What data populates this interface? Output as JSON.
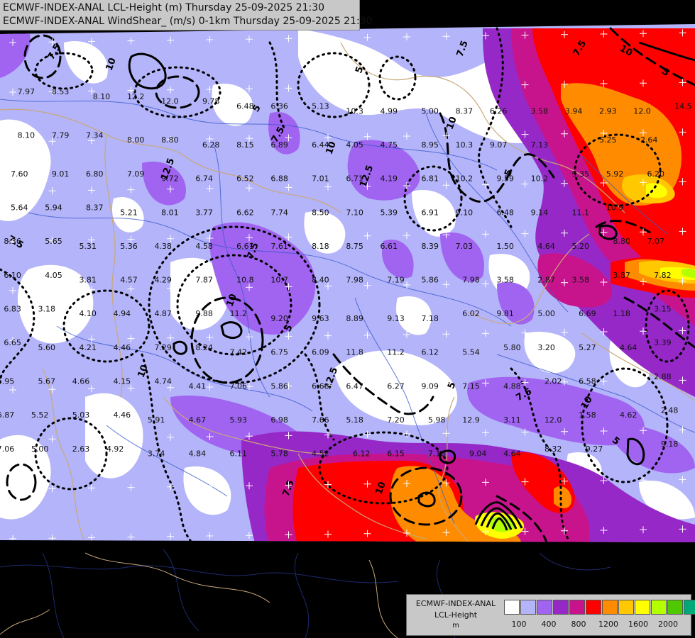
{
  "header": {
    "title_line_1": "ECMWF-INDEX-ANAL LCL-Height (m) Thursday 25-09-2025 21:30",
    "title_line_2": "ECMWF-INDEX-ANAL WindShear_ (m/s) 0-1km Thursday 25-09-2025 21:30"
  },
  "legend": {
    "line_1": "ECMWF-INDEX-ANAL",
    "line_2": "LCL-Height",
    "line_3": "m",
    "colors": [
      "#ffffff",
      "#b4b4fa",
      "#a064f0",
      "#9628c8",
      "#c8148c",
      "#ff0000",
      "#ff8c00",
      "#ffc800",
      "#ffff00",
      "#b4ff00",
      "#50c800",
      "#00aa78",
      "#00b4ff"
    ],
    "ticks": [
      "100",
      "400",
      "800",
      "1200",
      "1600",
      "2000"
    ]
  },
  "map": {
    "background_color": "#000000",
    "shear_contour_labels": [
      "7.5",
      "10",
      "12.5",
      "5",
      "7.5",
      "10",
      "5",
      "7.5",
      "10",
      "12.5",
      "5",
      "7.5",
      "10",
      "5",
      "7.5",
      "10",
      "5",
      "7.5",
      "10",
      "12.5",
      "5",
      "7.5",
      "10",
      "5",
      "7.5",
      "10"
    ],
    "station_values": [
      {
        "value": "7.97",
        "c": 0.03,
        "r": 0.1
      },
      {
        "value": "8.53",
        "c": 0.08,
        "r": 0.1
      },
      {
        "value": "8.10",
        "c": 0.14,
        "r": 0.11
      },
      {
        "value": "12.2",
        "c": 0.19,
        "r": 0.11
      },
      {
        "value": "12.0",
        "c": 0.24,
        "r": 0.12
      },
      {
        "value": "9.78",
        "c": 0.3,
        "r": 0.12
      },
      {
        "value": "6.48",
        "c": 0.35,
        "r": 0.13
      },
      {
        "value": "6.36",
        "c": 0.4,
        "r": 0.13
      },
      {
        "value": "5.13",
        "c": 0.46,
        "r": 0.13
      },
      {
        "value": "10.3",
        "c": 0.51,
        "r": 0.14
      },
      {
        "value": "4.99",
        "c": 0.56,
        "r": 0.14
      },
      {
        "value": "5.00",
        "c": 0.62,
        "r": 0.14
      },
      {
        "value": "8.37",
        "c": 0.67,
        "r": 0.14
      },
      {
        "value": "6.26",
        "c": 0.72,
        "r": 0.14
      },
      {
        "value": "3.58",
        "c": 0.78,
        "r": 0.14
      },
      {
        "value": "3.94",
        "c": 0.83,
        "r": 0.14
      },
      {
        "value": "2.93",
        "c": 0.88,
        "r": 0.14
      },
      {
        "value": "12.0",
        "c": 0.93,
        "r": 0.14
      },
      {
        "value": "14.5",
        "c": 0.99,
        "r": 0.13
      },
      {
        "value": "8.10",
        "c": 0.03,
        "r": 0.19
      },
      {
        "value": "7.79",
        "c": 0.08,
        "r": 0.19
      },
      {
        "value": "7.34",
        "c": 0.13,
        "r": 0.19
      },
      {
        "value": "8.00",
        "c": 0.19,
        "r": 0.2
      },
      {
        "value": "8.80",
        "c": 0.24,
        "r": 0.2
      },
      {
        "value": "6.28",
        "c": 0.3,
        "r": 0.21
      },
      {
        "value": "8.15",
        "c": 0.35,
        "r": 0.21
      },
      {
        "value": "6.89",
        "c": 0.4,
        "r": 0.21
      },
      {
        "value": "6.44",
        "c": 0.46,
        "r": 0.21
      },
      {
        "value": "4.05",
        "c": 0.51,
        "r": 0.21
      },
      {
        "value": "4.75",
        "c": 0.56,
        "r": 0.21
      },
      {
        "value": "8.95",
        "c": 0.62,
        "r": 0.21
      },
      {
        "value": "10.3",
        "c": 0.67,
        "r": 0.21
      },
      {
        "value": "9.07",
        "c": 0.72,
        "r": 0.21
      },
      {
        "value": "7.13",
        "c": 0.78,
        "r": 0.21
      },
      {
        "value": "5.25",
        "c": 0.88,
        "r": 0.2
      },
      {
        "value": "2.64",
        "c": 0.94,
        "r": 0.2
      },
      {
        "value": "7.60",
        "c": 0.02,
        "r": 0.27
      },
      {
        "value": "9.01",
        "c": 0.08,
        "r": 0.27
      },
      {
        "value": "6.80",
        "c": 0.13,
        "r": 0.27
      },
      {
        "value": "7.09",
        "c": 0.19,
        "r": 0.27
      },
      {
        "value": "9.72",
        "c": 0.24,
        "r": 0.28
      },
      {
        "value": "6.74",
        "c": 0.29,
        "r": 0.28
      },
      {
        "value": "6.52",
        "c": 0.35,
        "r": 0.28
      },
      {
        "value": "6.88",
        "c": 0.4,
        "r": 0.28
      },
      {
        "value": "7.01",
        "c": 0.46,
        "r": 0.28
      },
      {
        "value": "6.71",
        "c": 0.51,
        "r": 0.28
      },
      {
        "value": "4.19",
        "c": 0.56,
        "r": 0.28
      },
      {
        "value": "6.81",
        "c": 0.62,
        "r": 0.28
      },
      {
        "value": "10.2",
        "c": 0.67,
        "r": 0.28
      },
      {
        "value": "9.59",
        "c": 0.73,
        "r": 0.28
      },
      {
        "value": "10.2",
        "c": 0.78,
        "r": 0.28
      },
      {
        "value": "9.35",
        "c": 0.84,
        "r": 0.27
      },
      {
        "value": "5.92",
        "c": 0.89,
        "r": 0.27
      },
      {
        "value": "6.20",
        "c": 0.95,
        "r": 0.27
      },
      {
        "value": "5.64",
        "c": 0.02,
        "r": 0.34
      },
      {
        "value": "5.94",
        "c": 0.07,
        "r": 0.34
      },
      {
        "value": "8.37",
        "c": 0.13,
        "r": 0.34
      },
      {
        "value": "5.21",
        "c": 0.18,
        "r": 0.35
      },
      {
        "value": "8.01",
        "c": 0.24,
        "r": 0.35
      },
      {
        "value": "3.77",
        "c": 0.29,
        "r": 0.35
      },
      {
        "value": "6.62",
        "c": 0.35,
        "r": 0.35
      },
      {
        "value": "7.74",
        "c": 0.4,
        "r": 0.35
      },
      {
        "value": "8.50",
        "c": 0.46,
        "r": 0.35
      },
      {
        "value": "7.10",
        "c": 0.51,
        "r": 0.35
      },
      {
        "value": "5.39",
        "c": 0.56,
        "r": 0.35
      },
      {
        "value": "6.91",
        "c": 0.62,
        "r": 0.35
      },
      {
        "value": "9.10",
        "c": 0.67,
        "r": 0.35
      },
      {
        "value": "6.48",
        "c": 0.73,
        "r": 0.35
      },
      {
        "value": "9.14",
        "c": 0.78,
        "r": 0.35
      },
      {
        "value": "11.1",
        "c": 0.84,
        "r": 0.35
      },
      {
        "value": "10.9",
        "c": 0.89,
        "r": 0.34
      },
      {
        "value": "8.36",
        "c": 0.01,
        "r": 0.41
      },
      {
        "value": "5.65",
        "c": 0.07,
        "r": 0.41
      },
      {
        "value": "5.31",
        "c": 0.12,
        "r": 0.42
      },
      {
        "value": "5.36",
        "c": 0.18,
        "r": 0.42
      },
      {
        "value": "4.38",
        "c": 0.23,
        "r": 0.42
      },
      {
        "value": "4.58",
        "c": 0.29,
        "r": 0.42
      },
      {
        "value": "6.61",
        "c": 0.35,
        "r": 0.42
      },
      {
        "value": "7.61",
        "c": 0.4,
        "r": 0.42
      },
      {
        "value": "8.18",
        "c": 0.46,
        "r": 0.42
      },
      {
        "value": "8.75",
        "c": 0.51,
        "r": 0.42
      },
      {
        "value": "6.61",
        "c": 0.56,
        "r": 0.42
      },
      {
        "value": "8.39",
        "c": 0.62,
        "r": 0.42
      },
      {
        "value": "7.03",
        "c": 0.67,
        "r": 0.42
      },
      {
        "value": "1.50",
        "c": 0.73,
        "r": 0.42
      },
      {
        "value": "4.64",
        "c": 0.79,
        "r": 0.42
      },
      {
        "value": "5.20",
        "c": 0.84,
        "r": 0.42
      },
      {
        "value": "8.80",
        "c": 0.9,
        "r": 0.41
      },
      {
        "value": "7.07",
        "c": 0.95,
        "r": 0.41
      },
      {
        "value": "6.10",
        "c": 0.01,
        "r": 0.48
      },
      {
        "value": "4.05",
        "c": 0.07,
        "r": 0.48
      },
      {
        "value": "3.81",
        "c": 0.12,
        "r": 0.49
      },
      {
        "value": "4.57",
        "c": 0.18,
        "r": 0.49
      },
      {
        "value": "4.29",
        "c": 0.23,
        "r": 0.49
      },
      {
        "value": "7.87",
        "c": 0.29,
        "r": 0.49
      },
      {
        "value": "10.8",
        "c": 0.35,
        "r": 0.49
      },
      {
        "value": "10.7",
        "c": 0.4,
        "r": 0.49
      },
      {
        "value": "8.40",
        "c": 0.46,
        "r": 0.49
      },
      {
        "value": "7.98",
        "c": 0.51,
        "r": 0.49
      },
      {
        "value": "7.19",
        "c": 0.57,
        "r": 0.49
      },
      {
        "value": "5.86",
        "c": 0.62,
        "r": 0.49
      },
      {
        "value": "7.98",
        "c": 0.68,
        "r": 0.49
      },
      {
        "value": "3.58",
        "c": 0.73,
        "r": 0.49
      },
      {
        "value": "2.87",
        "c": 0.79,
        "r": 0.49
      },
      {
        "value": "3.58",
        "c": 0.84,
        "r": 0.49
      },
      {
        "value": "3.87",
        "c": 0.9,
        "r": 0.48
      },
      {
        "value": "7.82",
        "c": 0.96,
        "r": 0.48
      },
      {
        "value": "6.83",
        "c": 0.01,
        "r": 0.55
      },
      {
        "value": "3.18",
        "c": 0.06,
        "r": 0.55
      },
      {
        "value": "4.10",
        "c": 0.12,
        "r": 0.56
      },
      {
        "value": "4.94",
        "c": 0.17,
        "r": 0.56
      },
      {
        "value": "4.87",
        "c": 0.23,
        "r": 0.56
      },
      {
        "value": "9.88",
        "c": 0.29,
        "r": 0.56
      },
      {
        "value": "11.2",
        "c": 0.34,
        "r": 0.56
      },
      {
        "value": "9.20",
        "c": 0.4,
        "r": 0.57
      },
      {
        "value": "9.63",
        "c": 0.46,
        "r": 0.57
      },
      {
        "value": "8.89",
        "c": 0.51,
        "r": 0.57
      },
      {
        "value": "9.13",
        "c": 0.57,
        "r": 0.57
      },
      {
        "value": "7.18",
        "c": 0.62,
        "r": 0.57
      },
      {
        "value": "6.02",
        "c": 0.68,
        "r": 0.56
      },
      {
        "value": "9.81",
        "c": 0.73,
        "r": 0.56
      },
      {
        "value": "5.00",
        "c": 0.79,
        "r": 0.56
      },
      {
        "value": "6.69",
        "c": 0.85,
        "r": 0.56
      },
      {
        "value": "1.18",
        "c": 0.9,
        "r": 0.56
      },
      {
        "value": "3.15",
        "c": 0.96,
        "r": 0.55
      },
      {
        "value": "6.65",
        "c": 0.01,
        "r": 0.62
      },
      {
        "value": "5.60",
        "c": 0.06,
        "r": 0.63
      },
      {
        "value": "4.21",
        "c": 0.12,
        "r": 0.63
      },
      {
        "value": "4.46",
        "c": 0.17,
        "r": 0.63
      },
      {
        "value": "7.29",
        "c": 0.23,
        "r": 0.63
      },
      {
        "value": "8.24",
        "c": 0.29,
        "r": 0.63
      },
      {
        "value": "7.42",
        "c": 0.34,
        "r": 0.64
      },
      {
        "value": "6.75",
        "c": 0.4,
        "r": 0.64
      },
      {
        "value": "6.09",
        "c": 0.46,
        "r": 0.64
      },
      {
        "value": "11.8",
        "c": 0.51,
        "r": 0.64
      },
      {
        "value": "11.2",
        "c": 0.57,
        "r": 0.64
      },
      {
        "value": "6.12",
        "c": 0.62,
        "r": 0.64
      },
      {
        "value": "5.54",
        "c": 0.68,
        "r": 0.64
      },
      {
        "value": "5.80",
        "c": 0.74,
        "r": 0.63
      },
      {
        "value": "3.20",
        "c": 0.79,
        "r": 0.63
      },
      {
        "value": "5.27",
        "c": 0.85,
        "r": 0.63
      },
      {
        "value": "4.64",
        "c": 0.91,
        "r": 0.63
      },
      {
        "value": "3.39",
        "c": 0.96,
        "r": 0.62
      },
      {
        "value": "6.95",
        "c": 0.0,
        "r": 0.7
      },
      {
        "value": "5.67",
        "c": 0.06,
        "r": 0.7
      },
      {
        "value": "4.66",
        "c": 0.11,
        "r": 0.7
      },
      {
        "value": "4.15",
        "c": 0.17,
        "r": 0.7
      },
      {
        "value": "4.74",
        "c": 0.23,
        "r": 0.7
      },
      {
        "value": "4.41",
        "c": 0.28,
        "r": 0.71
      },
      {
        "value": "7.06",
        "c": 0.34,
        "r": 0.71
      },
      {
        "value": "5.86",
        "c": 0.4,
        "r": 0.71
      },
      {
        "value": "6.68",
        "c": 0.46,
        "r": 0.71
      },
      {
        "value": "6.47",
        "c": 0.51,
        "r": 0.71
      },
      {
        "value": "6.27",
        "c": 0.57,
        "r": 0.71
      },
      {
        "value": "9.09",
        "c": 0.62,
        "r": 0.71
      },
      {
        "value": "7.15",
        "c": 0.68,
        "r": 0.71
      },
      {
        "value": "4.88",
        "c": 0.74,
        "r": 0.71
      },
      {
        "value": "2.02",
        "c": 0.8,
        "r": 0.7
      },
      {
        "value": "6.58",
        "c": 0.85,
        "r": 0.7
      },
      {
        "value": "2.88",
        "c": 0.96,
        "r": 0.69
      },
      {
        "value": "6.87",
        "c": 0.0,
        "r": 0.77
      },
      {
        "value": "5.52",
        "c": 0.05,
        "r": 0.77
      },
      {
        "value": "5.03",
        "c": 0.11,
        "r": 0.77
      },
      {
        "value": "4.46",
        "c": 0.17,
        "r": 0.77
      },
      {
        "value": "5.91",
        "c": 0.22,
        "r": 0.78
      },
      {
        "value": "4.67",
        "c": 0.28,
        "r": 0.78
      },
      {
        "value": "5.93",
        "c": 0.34,
        "r": 0.78
      },
      {
        "value": "6.98",
        "c": 0.4,
        "r": 0.78
      },
      {
        "value": "7.66",
        "c": 0.46,
        "r": 0.78
      },
      {
        "value": "5.18",
        "c": 0.51,
        "r": 0.78
      },
      {
        "value": "7.20",
        "c": 0.57,
        "r": 0.78
      },
      {
        "value": "5.98",
        "c": 0.63,
        "r": 0.78
      },
      {
        "value": "12.9",
        "c": 0.68,
        "r": 0.78
      },
      {
        "value": "3.11",
        "c": 0.74,
        "r": 0.78
      },
      {
        "value": "12.0",
        "c": 0.8,
        "r": 0.78
      },
      {
        "value": "1.58",
        "c": 0.85,
        "r": 0.77
      },
      {
        "value": "4.62",
        "c": 0.91,
        "r": 0.77
      },
      {
        "value": "2.48",
        "c": 0.97,
        "r": 0.76
      },
      {
        "value": "7.06",
        "c": 0.0,
        "r": 0.84
      },
      {
        "value": "5.00",
        "c": 0.05,
        "r": 0.84
      },
      {
        "value": "2.63",
        "c": 0.11,
        "r": 0.84
      },
      {
        "value": "4.92",
        "c": 0.16,
        "r": 0.84
      },
      {
        "value": "3.74",
        "c": 0.22,
        "r": 0.85
      },
      {
        "value": "4.84",
        "c": 0.28,
        "r": 0.85
      },
      {
        "value": "6.11",
        "c": 0.34,
        "r": 0.85
      },
      {
        "value": "5.78",
        "c": 0.4,
        "r": 0.85
      },
      {
        "value": "4.52",
        "c": 0.46,
        "r": 0.85
      },
      {
        "value": "6.12",
        "c": 0.52,
        "r": 0.85
      },
      {
        "value": "6.15",
        "c": 0.57,
        "r": 0.85
      },
      {
        "value": "7.16",
        "c": 0.63,
        "r": 0.85
      },
      {
        "value": "9.04",
        "c": 0.69,
        "r": 0.85
      },
      {
        "value": "4.64",
        "c": 0.74,
        "r": 0.85
      },
      {
        "value": "8.32",
        "c": 0.8,
        "r": 0.84
      },
      {
        "value": "9.27",
        "c": 0.86,
        "r": 0.84
      },
      {
        "value": "9.18",
        "c": 0.97,
        "r": 0.83
      }
    ]
  }
}
